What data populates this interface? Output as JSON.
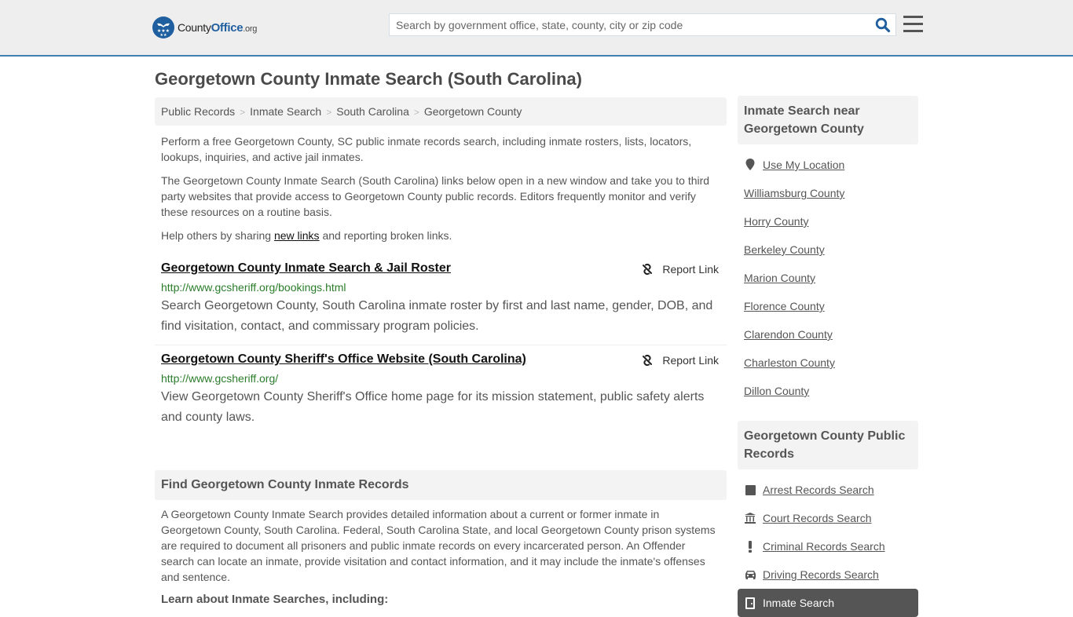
{
  "header": {
    "logo": {
      "name": "County",
      "name_accent": "Office",
      "tld": ".org"
    },
    "search_placeholder": "Search by government office, state, county, city or zip code",
    "search_value": ""
  },
  "page_title": "Georgetown County Inmate Search (South Carolina)",
  "breadcrumb": [
    "Public Records",
    "Inmate Search",
    "South Carolina",
    "Georgetown County"
  ],
  "breadcrumb_separator": ">",
  "intro": {
    "p1": "Perform a free Georgetown County, SC public inmate records search, including inmate rosters, lists, locators, lookups, inquiries, and active jail inmates.",
    "p2": "The Georgetown County Inmate Search (South Carolina) links below open in a new window and take you to third party websites that provide access to Georgetown County public records. Editors frequently monitor and verify these resources on a routine basis.",
    "p3_before": "Help others by sharing ",
    "p3_link": "new links",
    "p3_after": " and reporting broken links."
  },
  "results": [
    {
      "title": "Georgetown County Inmate Search & Jail Roster",
      "url": "http://www.gcsheriff.org/bookings.html",
      "description": "Search Georgetown County, South Carolina inmate roster by first and last name, gender, DOB, and find visitation, contact, and commissary program policies.",
      "report_label": "Report Link"
    },
    {
      "title": "Georgetown County Sheriff's Office Website (South Carolina)",
      "url": "http://www.gcsheriff.org/",
      "description": "View Georgetown County Sheriff's Office home page for its mission statement, public safety alerts and county laws.",
      "report_label": "Report Link"
    }
  ],
  "find_section": {
    "heading": "Find Georgetown County Inmate Records",
    "body": "A Georgetown County Inmate Search provides detailed information about a current or former inmate in Georgetown County, South Carolina. Federal, South Carolina State, and local Georgetown County prison systems are required to document all prisoners and public inmate records on every incarcerated person. An Offender search can locate an inmate, provide visitation and contact information, and it may include the inmate's offenses and sentence.",
    "subheading": "Learn about Inmate Searches, including:"
  },
  "sidebar": {
    "nearby": {
      "heading": "Inmate Search near Georgetown County",
      "use_location": "Use My Location",
      "counties": [
        "Williamsburg County",
        "Horry County",
        "Berkeley County",
        "Marion County",
        "Florence County",
        "Clarendon County",
        "Charleston County",
        "Dillon County"
      ]
    },
    "public_records": {
      "heading": "Georgetown County Public Records",
      "items": [
        {
          "label": "Arrest Records Search",
          "icon": "square-icon"
        },
        {
          "label": "Court Records Search",
          "icon": "courthouse-icon"
        },
        {
          "label": "Criminal Records Search",
          "icon": "exclamation-icon"
        },
        {
          "label": "Driving Records Search",
          "icon": "car-icon"
        },
        {
          "label": "Inmate Search",
          "icon": "door-icon",
          "active": true
        }
      ]
    }
  },
  "colors": {
    "header_bg": "#eeeeee",
    "header_border": "#3f7fb0",
    "brand_blue": "#1f5f9f",
    "url_green": "#2a7d2a",
    "active_bg": "#555555"
  }
}
